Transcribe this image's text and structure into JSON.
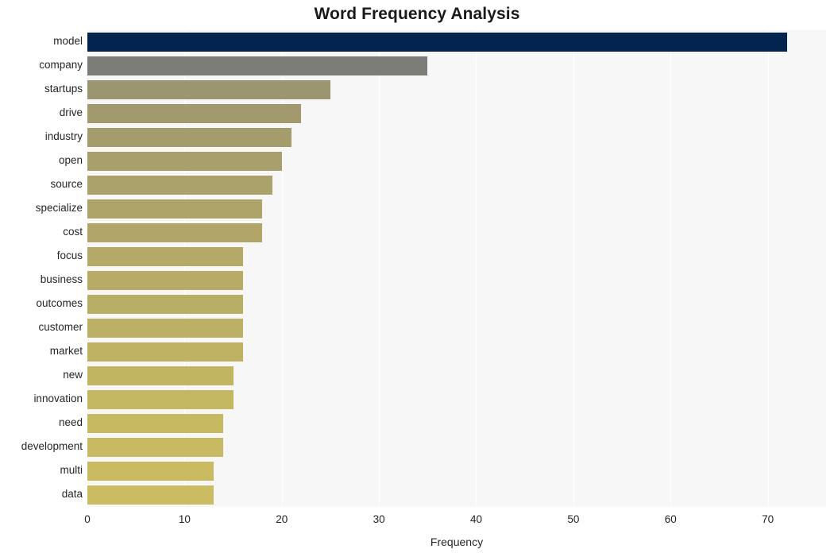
{
  "chart_data": {
    "type": "bar",
    "orientation": "horizontal",
    "title": "Word Frequency Analysis",
    "xlabel": "Frequency",
    "ylabel": "",
    "categories": [
      "model",
      "company",
      "startups",
      "drive",
      "industry",
      "open",
      "source",
      "specialize",
      "cost",
      "focus",
      "business",
      "outcomes",
      "customer",
      "market",
      "new",
      "innovation",
      "need",
      "development",
      "multi",
      "data"
    ],
    "values": [
      72,
      35,
      25,
      22,
      21,
      20,
      19,
      18,
      18,
      16,
      16,
      16,
      16,
      16,
      15,
      15,
      14,
      14,
      13,
      13
    ],
    "xlim": [
      0,
      76
    ],
    "xticks": [
      0,
      10,
      20,
      30,
      40,
      50,
      60,
      70
    ],
    "xtick_labels": [
      "0",
      "10",
      "20",
      "30",
      "40",
      "50",
      "60",
      "70"
    ],
    "grid": "vertical-white-on-light-gray",
    "legend": "none",
    "bar_colors": [
      "#042450",
      "#7c7c78",
      "#9b9670",
      "#a29a6e",
      "#a59c6d",
      "#a89f6c",
      "#aba16b",
      "#aea469",
      "#b1a668",
      "#b4a967",
      "#b7ab66",
      "#b9ae65",
      "#bcb064",
      "#bfb363",
      "#c2b562",
      "#c4b761",
      "#c6b962",
      "#c8ba62",
      "#cabb63",
      "#cbbc63"
    ],
    "plot_background": "#f7f7f7",
    "gridline_color": "#ffffff",
    "figure_background": "#ffffff"
  }
}
